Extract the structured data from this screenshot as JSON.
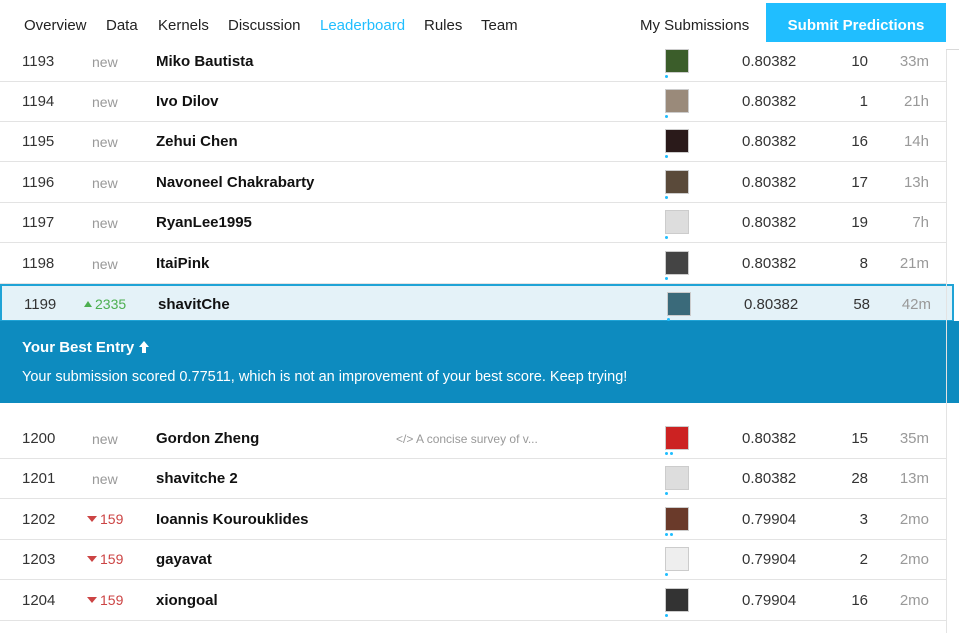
{
  "nav": {
    "tabs": [
      "Overview",
      "Data",
      "Kernels",
      "Discussion",
      "Leaderboard",
      "Rules",
      "Team"
    ],
    "active_tab": "Leaderboard",
    "my_submissions": "My Submissions",
    "submit_label": "Submit Predictions"
  },
  "rows_top": [
    {
      "rank": "1193",
      "change": "new",
      "name": "Miko Bautista",
      "score": "0.80382",
      "entries": "10",
      "last": "33m",
      "avatar_color": "#3b5d2a"
    },
    {
      "rank": "1194",
      "change": "new",
      "name": "Ivo Dilov",
      "score": "0.80382",
      "entries": "1",
      "last": "21h",
      "avatar_color": "#9a8a7a"
    },
    {
      "rank": "1195",
      "change": "new",
      "name": "Zehui Chen",
      "score": "0.80382",
      "entries": "16",
      "last": "14h",
      "avatar_color": "#2a1a1a"
    },
    {
      "rank": "1196",
      "change": "new",
      "name": "Navoneel Chakrabarty",
      "score": "0.80382",
      "entries": "17",
      "last": "13h",
      "avatar_color": "#5a4a3a"
    },
    {
      "rank": "1197",
      "change": "new",
      "name": "RyanLee1995",
      "score": "0.80382",
      "entries": "19",
      "last": "7h",
      "avatar_color": "#dddddd"
    },
    {
      "rank": "1198",
      "change": "new",
      "name": "ItaiPink",
      "score": "0.80382",
      "entries": "8",
      "last": "21m",
      "avatar_color": "#444444"
    }
  ],
  "my_row": {
    "rank": "1199",
    "change": "2335",
    "name": "shavitChe",
    "score": "0.80382",
    "entries": "58",
    "last": "42m",
    "avatar_color": "#3a6a7a"
  },
  "banner": {
    "title": "Your Best Entry",
    "message": "Your submission scored 0.77511, which is not an improvement of your best score. Keep trying!"
  },
  "rows_bottom": [
    {
      "rank": "1200",
      "change": "new",
      "name": "Gordon Zheng",
      "kernel": "</> A concise survey of v...",
      "score": "0.80382",
      "entries": "15",
      "last": "35m",
      "avatar_color": "#cc2222"
    },
    {
      "rank": "1201",
      "change": "new",
      "name": "shavitche 2",
      "score": "0.80382",
      "entries": "28",
      "last": "13m",
      "avatar_color": "#dddddd"
    },
    {
      "rank": "1202",
      "change": "159",
      "name": "Ioannis Kourouklides",
      "score": "0.79904",
      "entries": "3",
      "last": "2mo",
      "avatar_color": "#6a3a2a"
    },
    {
      "rank": "1203",
      "change": "159",
      "name": "gayavat",
      "score": "0.79904",
      "entries": "2",
      "last": "2mo",
      "avatar_color": "#eeeeee"
    },
    {
      "rank": "1204",
      "change": "159",
      "name": "xiongoal",
      "score": "0.79904",
      "entries": "16",
      "last": "2mo",
      "avatar_color": "#333333"
    }
  ]
}
